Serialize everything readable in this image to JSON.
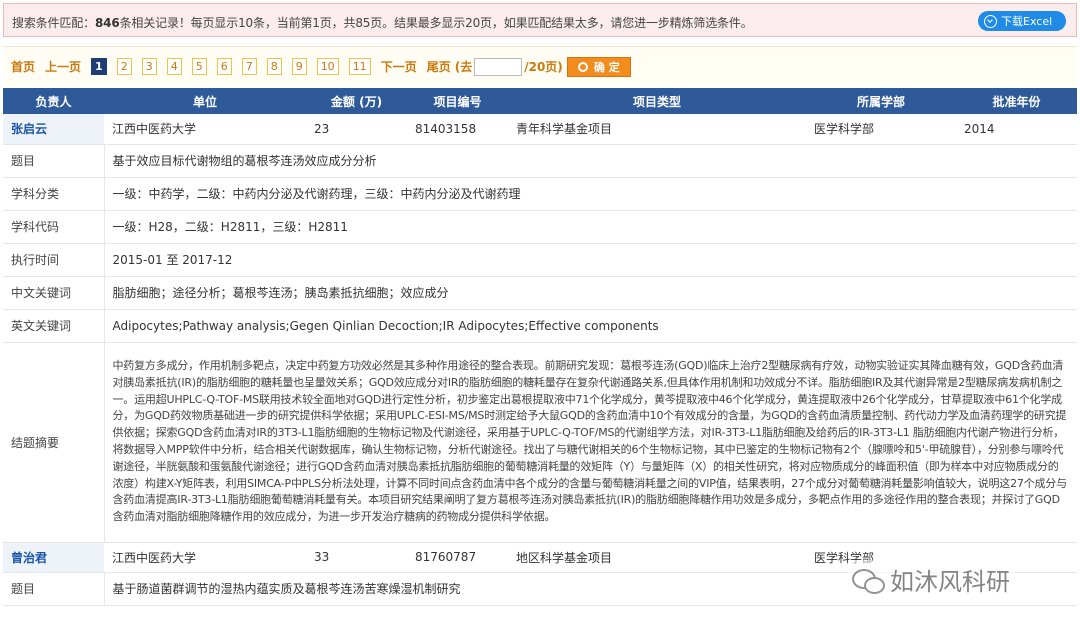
{
  "notice": {
    "prefix": "搜索条件匹配：",
    "count": "846",
    "text": "条相关记录！每页显示10条，当前第1页，共85页。结果最多显示20页，如果匹配结果太多，请您进一步精炼筛选条件。",
    "excel_label": "下载Excel"
  },
  "pager": {
    "first": "首页",
    "prev": "上一页",
    "pages": [
      "1",
      "2",
      "3",
      "4",
      "5",
      "6",
      "7",
      "8",
      "9",
      "10",
      "11"
    ],
    "current": "1",
    "next": "下一页",
    "last": "尾页",
    "goto_prefix": "(去",
    "goto_suffix": "/20页)",
    "ok_label": "确 定"
  },
  "table": {
    "headers": [
      "负责人",
      "单位",
      "金额 (万)",
      "项目编号",
      "项目类型",
      "所属学部",
      "批准年份"
    ],
    "records": [
      {
        "name": "张启云",
        "unit": "江西中医药大学",
        "amount": "23",
        "code": "81403158",
        "type": "青年科学基金项目",
        "dept": "医学科学部",
        "year": "2014",
        "details": [
          {
            "label": "题目",
            "value": "基于效应目标代谢物组的葛根芩连汤效应成分分析"
          },
          {
            "label": "学科分类",
            "value": "一级：中药学，二级：中药内分泌及代谢药理，三级：中药内分泌及代谢药理"
          },
          {
            "label": "学科代码",
            "value": "一级：H28，二级：H2811，三级：H2811"
          },
          {
            "label": "执行时间",
            "value": "2015-01 至 2017-12"
          },
          {
            "label": "中文关键词",
            "value": "脂肪细胞；途径分析；葛根芩连汤；胰岛素抵抗细胞；效应成分"
          },
          {
            "label": "英文关键词",
            "value": "Adipocytes;Pathway analysis;Gegen Qinlian Decoction;IR Adipocytes;Effective components"
          }
        ],
        "abstract_label": "结题摘要",
        "abstract": "中药复方多成分，作用机制多靶点，决定中药复方功效必然是其多种作用途径的整合表现。前期研究发现：葛根芩连汤(GQD)临床上治疗2型糖尿病有疗效，动物实验证实其降血糖有效，GQD含药血清对胰岛素抵抗(IR)的脂肪细胞的糖耗量也呈量效关系；GQD效应成分对IR的脂肪细胞的糖耗量存在复杂代谢通路关系,但具体作用机制和功效成分不详。脂肪细胞IR及其代谢异常是2型糖尿病发病机制之一。运用超UHPLC-Q-TOF-MS联用技术较全面地对GQD进行定性分析，初步鉴定出葛根提取液中71个化学成分，黄芩提取液中46个化学成分，黄连提取液中26个化学成分，甘草提取液中61个化学成分，为GQD药效物质基础进一步的研究提供科学依据；采用UPLC-ESI-MS/MS时测定给予大鼠GQD的含药血清中10个有效成分的含量，为GQD的含药血清质量控制、药代动力学及血清药理学的研究提供依据；探索GQD含药血清对IR的3T3-L1脂肪细胞的生物标记物及代谢途径，采用基于UPLC-Q-TOF/MS的代谢组学方法，对IR-3T3-L1脂肪细胞及给药后的IR-3T3-L1 脂肪细胞内代谢产物进行分析，将数据导入MPP软件中分析，结合相关代谢数据库，确认生物标记物，分析代谢途径。找出了与糖代谢相关的6个生物标记物，其中已鉴定的生物标记物有2个（腺嘌呤和5'-甲硫腺苷），分别参与嘌呤代谢途径，半胱氨酸和蛋氨酸代谢途径；进行GQD含药血清对胰岛素抵抗脂肪细胞的葡萄糖消耗量的效矩阵（Y）与量矩阵（X）的相关性研究，将对应物质成分的峰面积值（即为样本中对应物质成分的浓度）构建X-Y矩阵表，利用SIMCA-P中PLS分析法处理，计算不同时间点含药血清中各个成分的含量与葡萄糖消耗量之间的VIP值，结果表明，27个成分对葡萄糖消耗量影响值较大，说明这27个成分与含药血清提高IR-3T3-L1脂肪细胞葡萄糖消耗量有关。本项目研究结果阐明了复方葛根芩连汤对胰岛素抵抗(IR)的脂肪细胞降糖作用功效是多成分，多靶点作用的多途径作用的整合表现；并探讨了GQD含药血清对脂肪细胞降糖作用的效应成分，为进一步开发治疗糖病的药物成分提供科学依据。"
      },
      {
        "name": "曾治君",
        "unit": "江西中医药大学",
        "amount": "33",
        "code": "81760787",
        "type": "地区科学基金项目",
        "dept": "医学科学部",
        "details": [
          {
            "label": "题目",
            "value": "基于肠道菌群调节的湿热内蕴实质及葛根芩连汤苦寒燥湿机制研究"
          }
        ]
      }
    ]
  },
  "watermark": "如沐风科研",
  "colors": {
    "header_bg": "#2e5a9a",
    "name_link": "#1a54a8",
    "pager_link": "#c97a0e",
    "button_orange": "#f28c1d",
    "excel_blue": "#1f8be6"
  }
}
